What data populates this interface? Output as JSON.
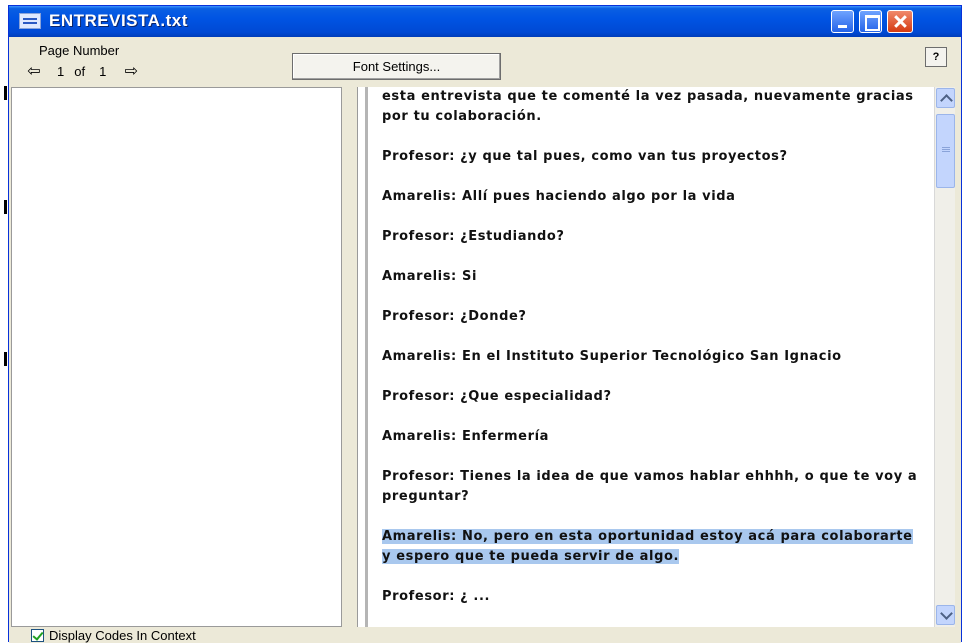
{
  "window": {
    "title": "ENTREVISTA.txt"
  },
  "toolbar": {
    "page_number_label": "Page Number",
    "current_page": "1",
    "of_label": "of",
    "total_pages": "1",
    "font_settings_label": "Font Settings...",
    "help_label": "?"
  },
  "document": {
    "paragraphs": [
      "esta entrevista que te comenté la vez pasada, nuevamente gracias por tu colaboración.",
      "Profesor: ¿y que tal pues, como van tus proyectos?",
      "Amarelis: Allí pues haciendo algo por la vida",
      "Profesor: ¿Estudiando?",
      "Amarelis: Si",
      "Profesor: ¿Donde?",
      "Amarelis: En el Instituto Superior Tecnológico San Ignacio",
      "Profesor: ¿Que especialidad?",
      "Amarelis: Enfermería",
      "Profesor: Tienes la idea de que vamos hablar ehhhh, o que te voy a preguntar?",
      "Amarelis: No, pero en esta oportunidad estoy acá para colaborarte y espero que te pueda servir de algo.",
      "Profesor: ¿ ... "
    ]
  },
  "status": {
    "checkbox_label": "Display Codes In Context",
    "checked": true
  },
  "colors": {
    "highlight": "#a9c8ee",
    "titlebar": "#0054e3"
  }
}
